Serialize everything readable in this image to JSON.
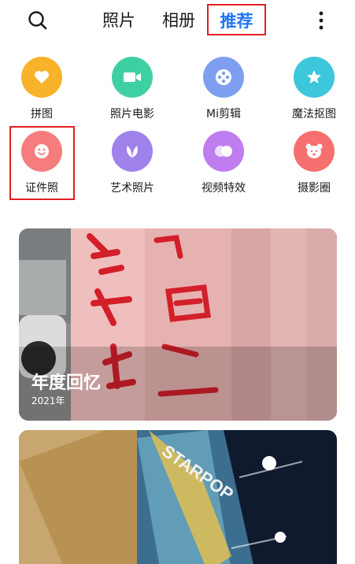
{
  "header": {
    "tabs": [
      {
        "label": "照片"
      },
      {
        "label": "相册"
      },
      {
        "label": "推荐",
        "active": true
      }
    ],
    "search_icon": "search-icon",
    "more_icon": "more-vertical-icon"
  },
  "features": [
    {
      "label": "拼图",
      "icon": "heart-icon",
      "color": "#f8b32b"
    },
    {
      "label": "照片电影",
      "icon": "video-camera-icon",
      "color": "#3ed0a3"
    },
    {
      "label": "Mi剪辑",
      "icon": "film-reel-icon",
      "color": "#7e9ff0"
    },
    {
      "label": "魔法抠图",
      "icon": "star-icon",
      "color": "#3cc7da"
    },
    {
      "label": "证件照",
      "icon": "smiley-face-icon",
      "color": "#f57d7d"
    },
    {
      "label": "艺术照片",
      "icon": "leaf-icon",
      "color": "#9f82ec"
    },
    {
      "label": "视频特效",
      "icon": "overlapping-circles-icon",
      "color": "#c07df0"
    },
    {
      "label": "摄影圈",
      "icon": "bear-face-icon",
      "color": "#f6706f"
    }
  ],
  "cards": [
    {
      "title": "年度回忆",
      "subtitle": "2021年"
    },
    {
      "title": "",
      "subtitle": ""
    }
  ],
  "colors": {
    "accent": "#1e74f5",
    "highlight_border": "#e21f1f"
  }
}
